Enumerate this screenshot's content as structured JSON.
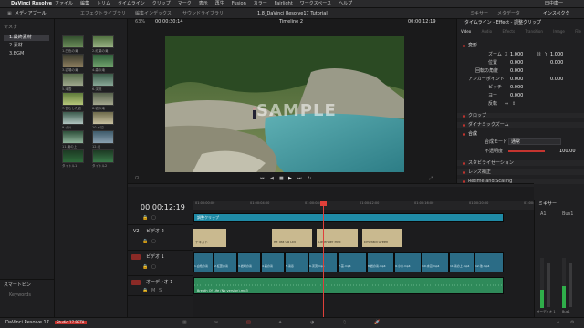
{
  "mac_menu": {
    "app": "DaVinci Resolve",
    "items": [
      "ファイル",
      "編集",
      "トリム",
      "タイムライン",
      "クリップ",
      "マーク",
      "表示",
      "再生",
      "Fusion",
      "カラー",
      "Fairlight",
      "ワークスペース",
      "ヘルプ"
    ],
    "right_user": "田中康一"
  },
  "toolbar": {
    "media_pool": "メディアプール",
    "effects": "エフェクトライブラリ",
    "edit_index": "編集インデックス",
    "sound_library": "サウンドライブラリ",
    "project_title": "1.8_DaVinci Resolve17 Tutorial",
    "mixer": "ミキサー",
    "metadata": "メタデータ",
    "inspector": "インスペクタ"
  },
  "left_panel": {
    "header": "マスター",
    "bins": [
      "1.最終素材",
      "2.素材",
      "3.BGM"
    ],
    "clip_names": [
      "1.白色の滝",
      "2.紅葉の滝",
      "3.岩場の滝",
      "4.森の滝",
      "5.滝壺",
      "6.渓流",
      "7.苔むした岩",
      "8.岩の滝",
      "9.小川",
      "10.水辺",
      "11.滝の上",
      "12.池",
      "タイトル1",
      "タイトル2"
    ],
    "smart_bins": "スマートビン",
    "smart_bins_sub": "Keywords"
  },
  "viewer": {
    "zoom": "63%",
    "timecode_left": "00:00:30:14",
    "timeline_name": "Timeline 2",
    "timecode_right": "00:00:12:19",
    "watermark": "SAMPLE"
  },
  "inspector": {
    "title": "タイムライン - Effect - 調整クリップ",
    "tabs": [
      "Video",
      "Audio",
      "Effects",
      "Transition",
      "Image",
      "File"
    ],
    "sections": [
      "変形",
      "クロップ",
      "ダイナミックズーム",
      "合成",
      "スタビライゼーション",
      "レンズ補正",
      "Retime and Scaling"
    ],
    "transform": {
      "zoom_label": "ズーム",
      "zoom_x": "1.000",
      "zoom_y": "1.000",
      "position_label": "位置",
      "position_x": "0.000",
      "position_y": "0.000",
      "rotation_label": "回転の角度",
      "rotation": "0.000",
      "anchor_label": "アンカーポイント",
      "anchor_x": "0.000",
      "anchor_y": "0.000",
      "pitch_label": "ピッチ",
      "pitch": "0.000",
      "yaw_label": "ヨー",
      "yaw": "0.000",
      "flip_label": "反転"
    },
    "composite": {
      "mode_label": "合成モード",
      "mode_value": "通常",
      "opacity_label": "不透明度",
      "opacity_value": "100.00"
    }
  },
  "timeline": {
    "timecode": "00:00:12:19",
    "tracks": [
      {
        "id": "V3",
        "name": "",
        "clip": "調整クリップ"
      },
      {
        "id": "V2",
        "name": "ビデオ 2"
      },
      {
        "id": "V1",
        "name": "ビデオ 1"
      },
      {
        "id": "A1",
        "name": "オーディオ 1",
        "audio_clip": "Breath Of Life (No version).mp3"
      }
    ],
    "v2_clips": [
      "テキスト",
      "Re Tea Co Ltd",
      "Lavender Mist",
      "Emerald Green"
    ],
    "v1_clips": [
      "1.白色の滝",
      "2.紅葉の滝",
      "3.岩場の滝",
      "4.森の滝",
      "5.滝壺",
      "6.渓流.mp4",
      "7.苔.mp4",
      "8.岩の滝.mp4",
      "9.小川.mp4",
      "10.水辺.mp4",
      "11.滝の上.mp4",
      "12.池.mp4"
    ],
    "ruler": [
      "01:00:00:00",
      "01:00:04:00",
      "01:00:08:00",
      "01:00:12:00",
      "01:00:16:00",
      "01:00:20:00",
      "01:00:24:00"
    ]
  },
  "mixer": {
    "title": "ミキサー",
    "channels": [
      "A1",
      "Bus1"
    ],
    "label_a1": "オーディオ 1",
    "label_bus": "Bus1"
  },
  "page_bar": {
    "app": "DaVinci Resolve 17",
    "badge": "Studio 17 BETA",
    "pages": [
      "media",
      "cut",
      "edit",
      "fusion",
      "color",
      "fairlight",
      "deliver"
    ]
  },
  "colors": {
    "accent": "#e0403a",
    "v3": "#1f8aa6",
    "v1": "#2b6c86",
    "a1": "#2f8a5a",
    "title": "#c9b98f"
  }
}
